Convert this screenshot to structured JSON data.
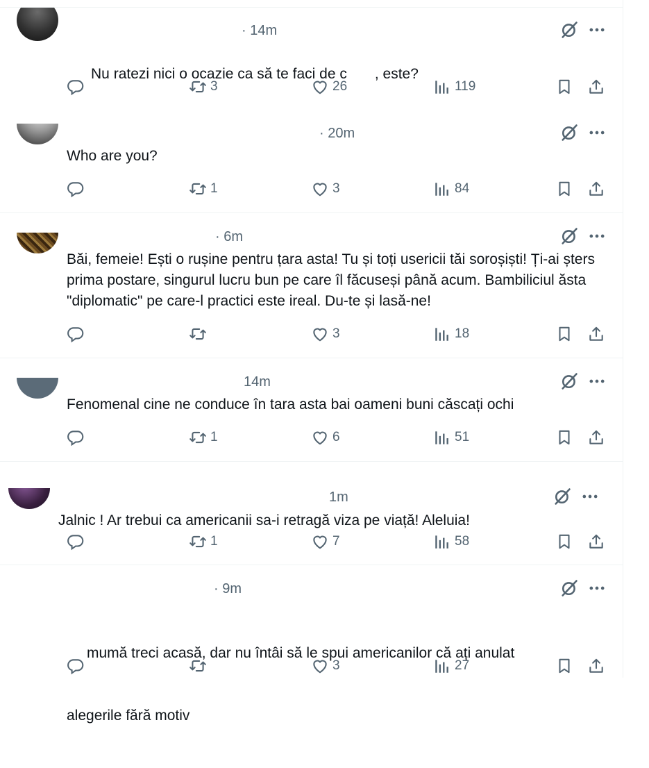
{
  "posts": [
    {
      "time": "· 14m",
      "text": "Nu ratezi nici o ocazie ca să te faci de c",
      "text_tail": ", este?",
      "replies": "",
      "reposts": "3",
      "likes": "26",
      "views": "119"
    },
    {
      "time": "· 20m",
      "text": "Who are you?",
      "replies": "",
      "reposts": "1",
      "likes": "3",
      "views": "84"
    },
    {
      "time": "· 6m",
      "text": "Băi, femeie! Ești o rușine pentru țara asta! Tu și toți usericii tăi soroșiști! Ți-ai șters prima postare, singurul lucru bun pe care îl făcuseși până acum. Bambiliciul ăsta \"diplomatic\" pe care-l practici este ireal. Du-te și lasă-ne!",
      "replies": "",
      "reposts": "",
      "likes": "3",
      "views": "18"
    },
    {
      "time": "14m",
      "text": "Fenomenal cine ne conduce în tara asta bai oameni buni căscați ochi",
      "replies": "",
      "reposts": "1",
      "likes": "6",
      "views": "51"
    },
    {
      "time": "1m",
      "text": "Jalnic ! Ar trebui ca americanii sa-i retragă viza pe viață! Aleluia!",
      "replies": "",
      "reposts": "1",
      "likes": "7",
      "views": "58"
    },
    {
      "time": "· 9m",
      "text": "mumă treci acasă, dar nu întâi să le spui americanilor că ați anulat",
      "text2": "alegerile fără motiv",
      "replies": "",
      "reposts": "",
      "likes": "3",
      "views": "27"
    }
  ],
  "icons": {
    "reply": "reply-icon",
    "repost": "repost-icon",
    "like": "heart-icon",
    "views": "views-icon",
    "bookmark": "bookmark-icon",
    "share": "share-icon",
    "grok": "grok-icon",
    "more": "more-icon"
  },
  "colors": {
    "text": "#0f1419",
    "muted": "#536471",
    "divider": "#eff3f4"
  }
}
